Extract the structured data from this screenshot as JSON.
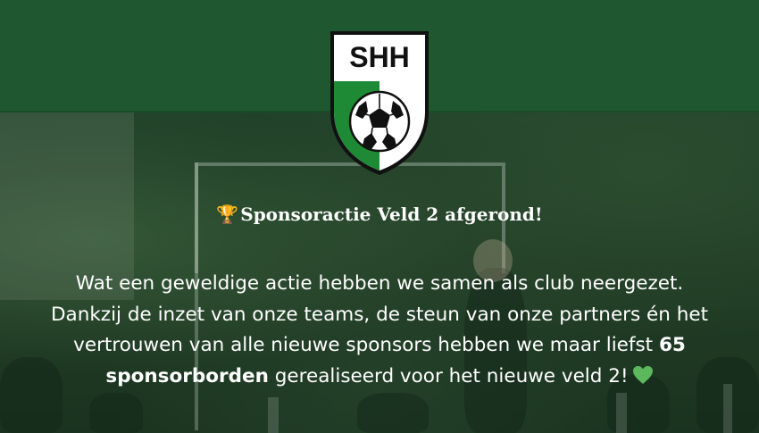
{
  "logo": {
    "text": "SHH",
    "icon": "shield-soccer-ball-logo",
    "colors": {
      "green": "#1e8a35",
      "black": "#111111",
      "white": "#ffffff"
    }
  },
  "post": {
    "title_emoji": "🏆",
    "title": "Sponsoractie Veld 2 afgerond!",
    "line1": "Wat een geweldige actie hebben we samen als club neergezet.",
    "line2": "Dankzij de inzet van onze teams, de steun van onze partners én het",
    "line3_part1": "vertrouwen van alle nieuwe sponsors hebben we maar liefst ",
    "line3_bold": "65",
    "line4_bold": "sponsorborden",
    "line4_part2": " gerealiseerd voor het nieuwe veld 2!",
    "heart_icon": "green-heart-icon"
  },
  "colors": {
    "top_band": "#1f5a31",
    "background": "#1d3b24",
    "text": "#ffffff",
    "heart": "#5cb85c",
    "trophy": "#e8b13a"
  }
}
